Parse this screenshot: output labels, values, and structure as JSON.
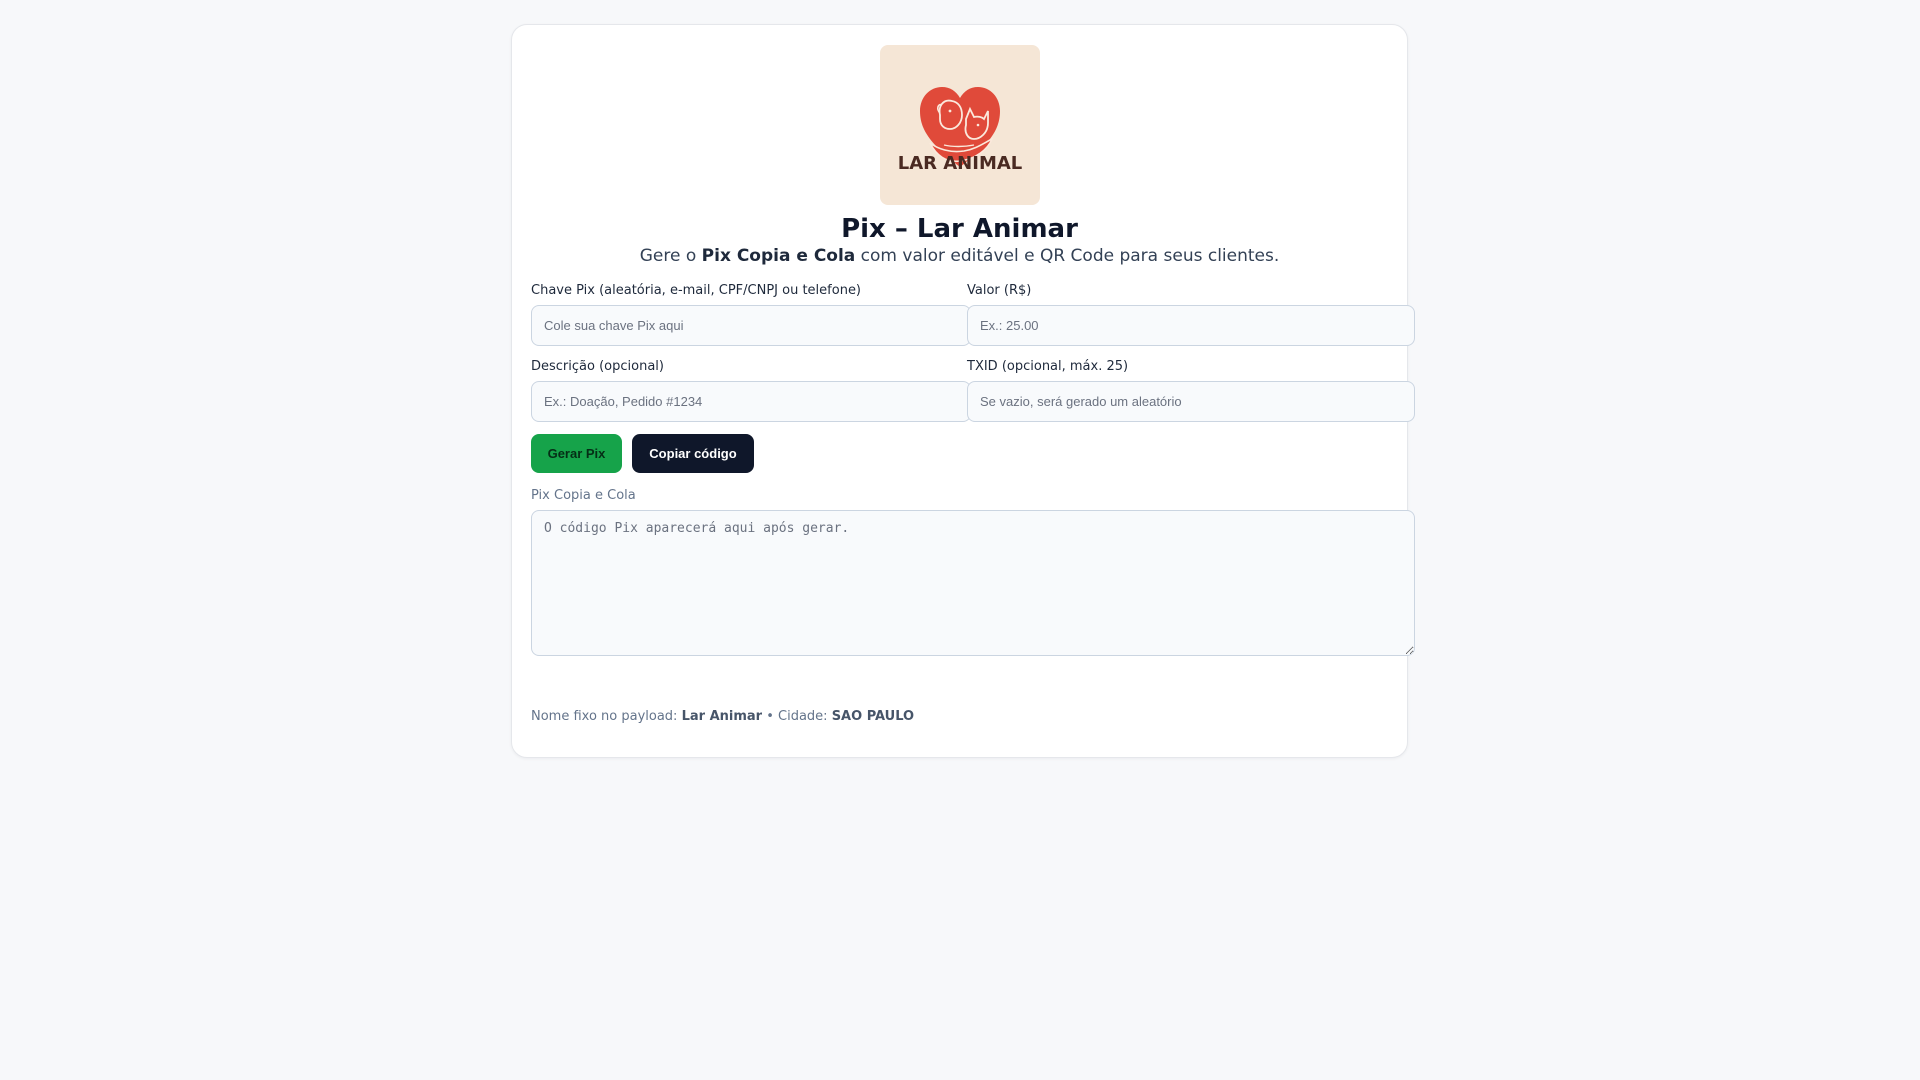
{
  "brand": {
    "logo_text": "LAR ANIMAL",
    "colors": {
      "logo_bg": "#f5e6d6",
      "heart": "#e04a3a",
      "logo_text": "#4a2a22"
    }
  },
  "header": {
    "title": "Pix – Lar Animar",
    "subtitle_prefix": "Gere o ",
    "subtitle_bold": "Pix Copia e Cola",
    "subtitle_suffix": " com valor editável e QR Code para seus clientes."
  },
  "form": {
    "chave": {
      "label": "Chave Pix (aleatória, e-mail, CPF/CNPJ ou telefone)",
      "value": "",
      "placeholder": "Cole sua chave Pix aqui"
    },
    "valor": {
      "label": "Valor (R$)",
      "value": "",
      "placeholder": "Ex.: 25.00"
    },
    "descricao": {
      "label": "Descrição (opcional)",
      "value": "",
      "placeholder": "Ex.: Doação, Pedido #1234"
    },
    "txid": {
      "label": "TXID (opcional, máx. 25)",
      "value": "",
      "placeholder": "Se vazio, será gerado um aleatório"
    }
  },
  "actions": {
    "generate_label": "Gerar Pix",
    "copy_label": "Copiar código",
    "colors": {
      "generate_bg": "#16a34a",
      "copy_bg": "#0f172a"
    }
  },
  "output": {
    "label": "Pix Copia e Cola",
    "value": "",
    "placeholder": "O código Pix aparecerá aqui após gerar."
  },
  "footer": {
    "name_prefix": "Nome fixo no payload: ",
    "name_value": "Lar Animar",
    "separator": " • Cidade: ",
    "city_value": "SAO PAULO"
  }
}
